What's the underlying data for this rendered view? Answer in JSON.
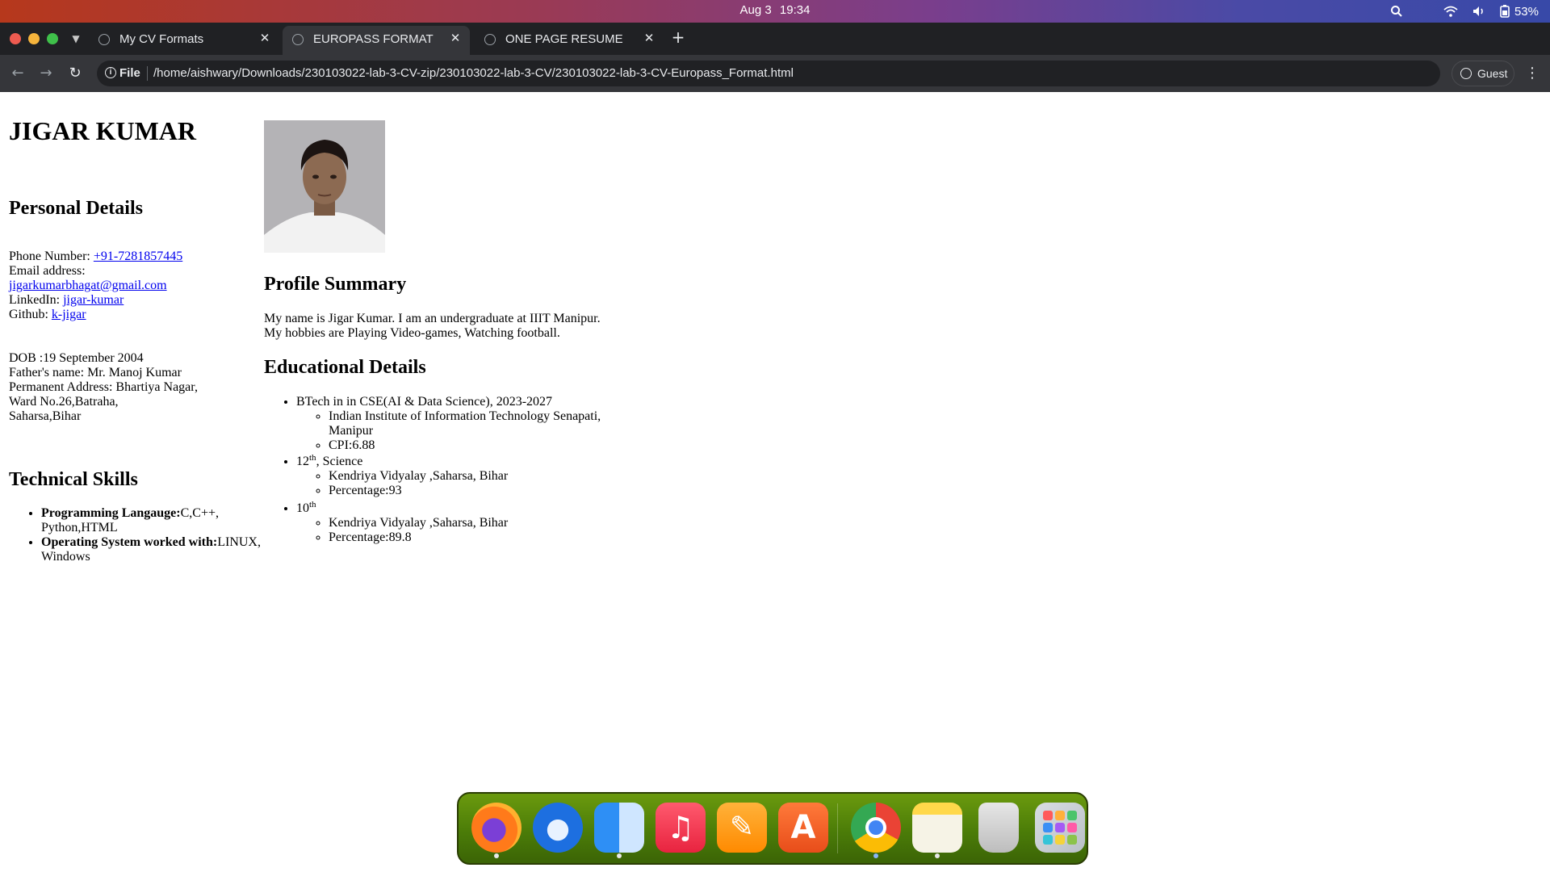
{
  "system_bar": {
    "date": "Aug 3",
    "time": "19:34",
    "battery": "53%"
  },
  "browser": {
    "tabs": [
      {
        "label": "My CV Formats",
        "active": false
      },
      {
        "label": "EUROPASS FORMAT",
        "active": true
      },
      {
        "label": "ONE PAGE RESUME",
        "active": false
      }
    ],
    "address_chip": "File",
    "url": "/home/aishwary/Downloads/230103022-lab-3-CV-zip/230103022-lab-3-CV/230103022-lab-3-CV-Europass_Format.html",
    "profile_label": "Guest"
  },
  "cv": {
    "name": "JIGAR KUMAR",
    "personal": {
      "heading": "Personal Details",
      "phone_label": "Phone Number: ",
      "phone": "+91-7281857445",
      "email_label": "Email address:",
      "email": "jigarkumarbhagat@gmail.com",
      "linkedin_label": "LinkedIn: ",
      "linkedin": "jigar-kumar",
      "github_label": "Github: ",
      "github": "k-jigar",
      "dob": "DOB :19 September 2004",
      "father": "Father's name: Mr. Manoj Kumar",
      "address_line1": "Permanent Address: Bhartiya Nagar,",
      "address_line2": "Ward No.26,Batraha,",
      "address_line3": "Saharsa,Bihar"
    },
    "skills": {
      "heading": "Technical Skills",
      "items": [
        {
          "label": "Programming Langauge:",
          "value_line1": "C,C++,",
          "value_line2": "Python,HTML"
        },
        {
          "label": "Operating System worked with:",
          "value_line1": "LINUX,",
          "value_line2": "Windows"
        }
      ]
    },
    "profile": {
      "heading": "Profile Summary",
      "line1": "My name is Jigar Kumar. I am an undergraduate at IIIT Manipur.",
      "line2": "My hobbies are Playing Video-games, Watching football."
    },
    "education": {
      "heading": "Educational Details",
      "btech": {
        "title": "BTech in in CSE(AI & Data Science), 2023-2027",
        "institute_line1": "Indian Institute of Information Technology Senapati,",
        "institute_line2": "Manipur",
        "cpi": "CPI:6.88"
      },
      "twelfth": {
        "num": "12",
        "sup": "th",
        "suffix": ", Science",
        "school": "Kendriya Vidyalay ,Saharsa, Bihar",
        "percentage": "Percentage:93"
      },
      "tenth": {
        "num": "10",
        "sup": "th",
        "school": "Kendriya Vidyalay ,Saharsa, Bihar",
        "percentage": "Percentage:89.8"
      }
    }
  },
  "dock": {
    "apps": [
      "firefox-icon",
      "thunderbird-icon",
      "finder-icon",
      "music-icon",
      "pages-icon",
      "app-store-icon",
      "chrome-icon",
      "notes-icon",
      "trash-icon",
      "launchpad-icon"
    ]
  }
}
